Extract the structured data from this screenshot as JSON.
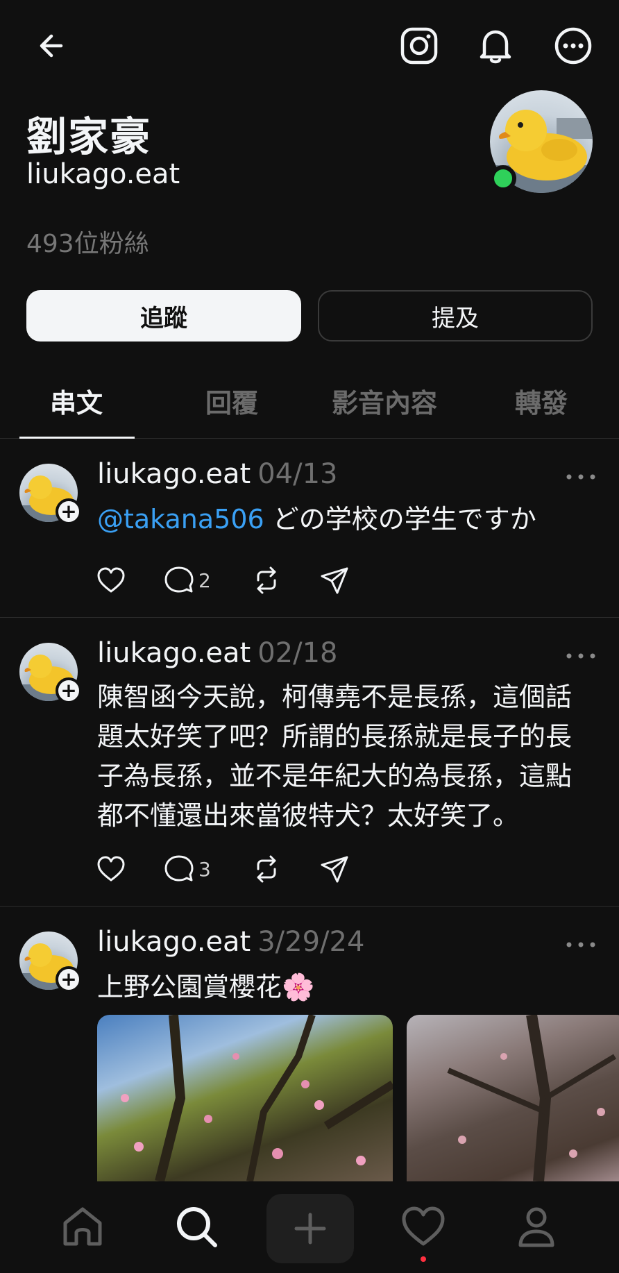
{
  "profile": {
    "name": "劉家豪",
    "handle": "liukago.eat",
    "followers": "493位粉絲",
    "follow_label": "追蹤",
    "mention_label": "提及"
  },
  "tabs": [
    {
      "label": "串文",
      "active": true
    },
    {
      "label": "回覆",
      "active": false
    },
    {
      "label": "影音內容",
      "active": false
    },
    {
      "label": "轉發",
      "active": false
    }
  ],
  "posts": [
    {
      "username": "liukago.eat",
      "date": "04/13",
      "mention": "@takana506",
      "text": " どの学校の学生ですか",
      "reply_count": "2"
    },
    {
      "username": "liukago.eat",
      "date": "02/18",
      "text": "陳智函今天說，柯傳堯不是長孫，這個話題太好笑了吧？所謂的長孫就是長子的長子為長孫，並不是年紀大的為長孫，這點都不懂還出來當彼特犬？太好笑了。",
      "reply_count": "3"
    },
    {
      "username": "liukago.eat",
      "date": "3/29/24",
      "text": "上野公園賞櫻花🌸"
    }
  ],
  "colors": {
    "background": "#101010",
    "mention": "#3aa0f4",
    "online": "#2fd15a",
    "notification_dot": "#ff3040"
  },
  "icons": {
    "top": [
      "back-arrow-icon",
      "instagram-icon",
      "bell-icon",
      "more-circle-icon"
    ],
    "post_actions": [
      "heart-icon",
      "comment-icon",
      "repost-icon",
      "share-icon"
    ],
    "bottom_nav": [
      "home-icon",
      "search-icon",
      "create-icon",
      "activity-heart-icon",
      "profile-icon"
    ]
  }
}
